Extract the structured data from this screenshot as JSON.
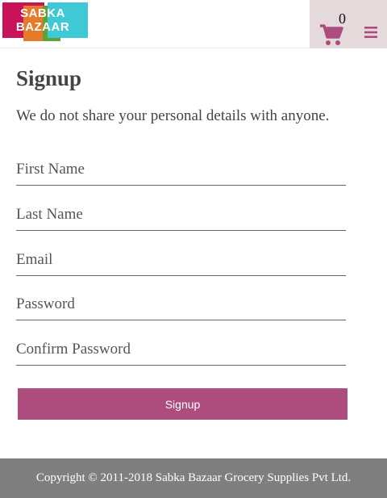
{
  "brand": {
    "logo_line1": "SABKA",
    "logo_line2": "BAZAAR",
    "colors": [
      "#c8135a",
      "#e47a2a",
      "#5fa336",
      "#3fc8d6"
    ]
  },
  "header": {
    "cart_icon": "cart-icon",
    "cart_count": "0",
    "menu_icon": "hamburger-menu-icon"
  },
  "signup": {
    "title": "Signup",
    "subtitle": "We do not share your personal details with anyone.",
    "fields": {
      "first_name": "First Name",
      "last_name": "Last Name",
      "email": "Email",
      "password": "Password",
      "confirm_password": "Confirm Password"
    },
    "submit_label": "Signup"
  },
  "footer": {
    "copyright": "Copyright © 2011-2018 Sabka Bazaar Grocery Supplies Pvt Ltd."
  },
  "theme": {
    "accent": "#ac4d7e",
    "cart_bg": "#e6d9dc",
    "footer_bg": "#7f7f7f"
  }
}
